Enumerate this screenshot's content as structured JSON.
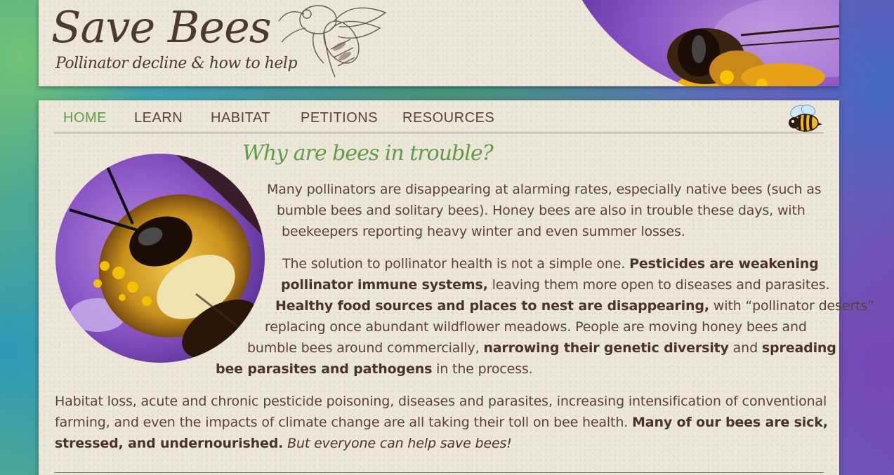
{
  "header": {
    "title": "Save Bees",
    "tagline": "Pollinator decline & how to help"
  },
  "nav": {
    "items": [
      "HOME",
      "LEARN",
      "HABITAT",
      "PETITIONS",
      "RESOURCES"
    ],
    "active": "HOME"
  },
  "main": {
    "heading": "Why are bees in trouble?",
    "p1": {
      "l1": "Many pollinators are disappearing at alarming rates, especially native bees (such as",
      "l2": "bumble bees and solitary bees). Honey bees are also in trouble these days, with",
      "l3": "beekeepers reporting heavy winter and even summer losses."
    },
    "p2": {
      "l1_a": "The solution to pollinator health is not a simple one. ",
      "l1_b": "Pesticides are weakening",
      "l2_a": "pollinator immune systems,",
      "l2_b": " leaving them more open to diseases and parasites.",
      "l3_a": "Healthy food sources and places to nest are disappearing,",
      "l3_b": " with “pollinator deserts”",
      "l4": "replacing once abundant wildflower meadows. People are moving honey bees and",
      "l5_a": "bumble bees around commercially, ",
      "l5_b": "narrowing their genetic diversity",
      "l5_c": " and ",
      "l5_d": "spreading",
      "l6_a": "bee parasites and pathogens",
      "l6_b": " in the process."
    },
    "p3": {
      "l1": "Habitat loss, acute and chronic pesticide poisoning, diseases and parasites, increasing intensification of conventional",
      "l2_a": "farming, and even the impacts of climate change are all taking their toll on bee health. ",
      "l2_b": "Many of our bees are sick,",
      "l3_a": "stressed, and undernourished.",
      "l3_b": " But everyone can help save bees!"
    }
  },
  "colors": {
    "accent_green": "#5f9c46",
    "text_brown": "#5a4234",
    "paper": "#ede7da"
  },
  "icons": [
    "bee-sketch-illustration",
    "bee-cartoon-icon"
  ]
}
